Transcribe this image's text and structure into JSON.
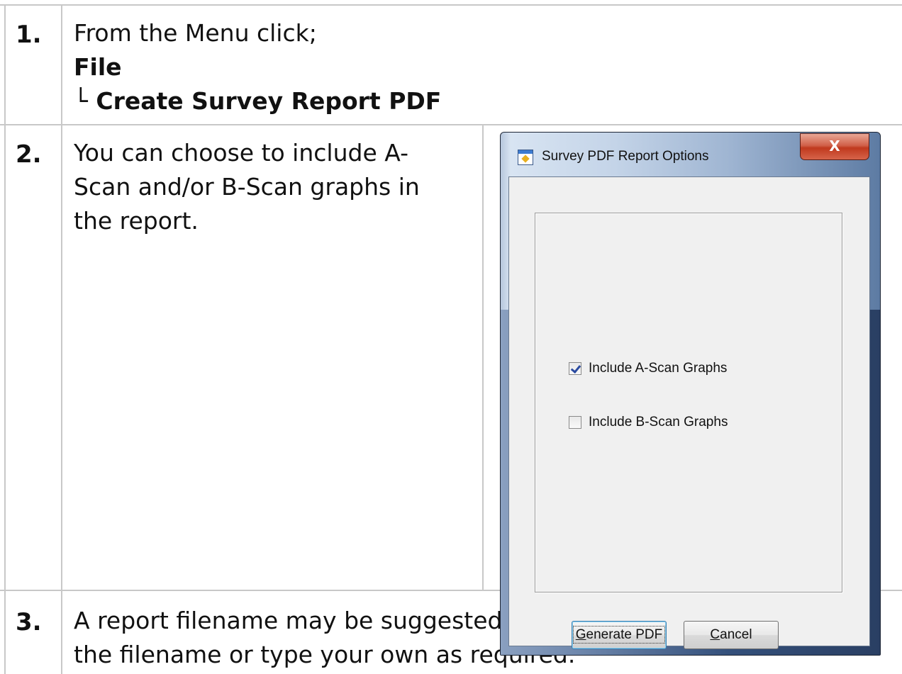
{
  "steps": [
    {
      "number": "1.",
      "lines": [
        "From the Menu click;",
        "File",
        "└ Create Survey Report PDF"
      ]
    },
    {
      "number": "2.",
      "lines": [
        "You can choose to include A-",
        "Scan and/or B-Scan graphs in",
        "the report."
      ]
    },
    {
      "number": "3.",
      "lines": [
        "A report filename may be suggested, you can continue with",
        "the filename or type your own as required."
      ]
    }
  ],
  "dialog": {
    "title": "Survey PDF Report Options",
    "close_label": "X",
    "options": [
      {
        "label": "Include A-Scan Graphs",
        "checked": true
      },
      {
        "label": "Include B-Scan Graphs",
        "checked": false
      }
    ],
    "generate_label_mnemonic": "G",
    "generate_label_rest": "enerate PDF",
    "cancel_label_mnemonic": "C",
    "cancel_label_rest": "ancel"
  }
}
